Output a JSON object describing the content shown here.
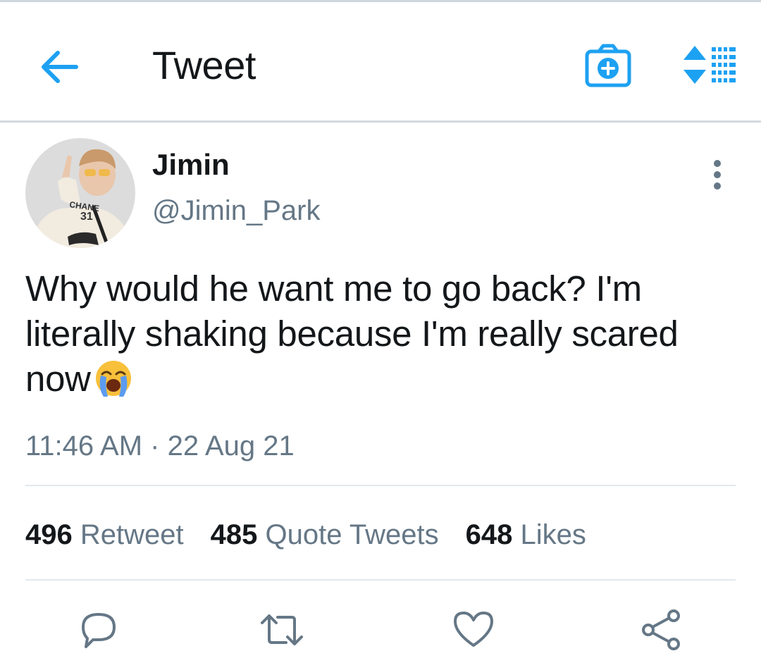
{
  "header": {
    "title": "Tweet",
    "back_icon": "arrow-left-icon",
    "camera_icon": "camera-plus-icon",
    "sort_icon": "sort-list-icon",
    "accent_color": "#1da1f2"
  },
  "tweet": {
    "author": {
      "display_name": "Jimin",
      "handle": "@Jimin_Park"
    },
    "text": "Why would he want me to go back? I'm literally shaking because I'm really scared now",
    "emoji": "loudly-crying-face",
    "timestamp": "11:46 AM · 22 Aug 21",
    "more_icon": "more-vertical-icon"
  },
  "stats": [
    {
      "count": "496",
      "label": "Retweet"
    },
    {
      "count": "485",
      "label": "Quote Tweets"
    },
    {
      "count": "648",
      "label": "Likes"
    }
  ],
  "actions": [
    {
      "icon": "reply-icon"
    },
    {
      "icon": "retweet-icon"
    },
    {
      "icon": "like-icon"
    },
    {
      "icon": "share-icon"
    }
  ],
  "colors": {
    "text_primary": "#14171a",
    "text_secondary": "#657786",
    "divider": "#e1e8ed"
  }
}
